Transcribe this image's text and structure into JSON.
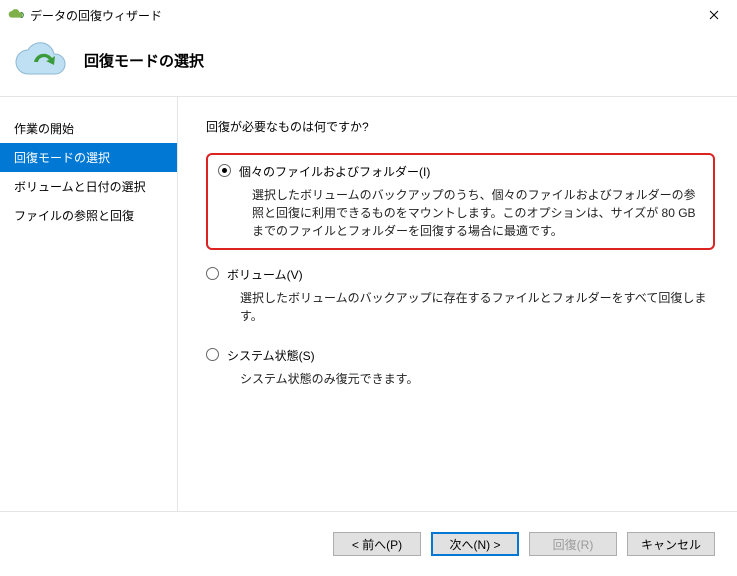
{
  "titlebar": {
    "title": "データの回復ウィザード"
  },
  "header": {
    "heading": "回復モードの選択"
  },
  "sidebar": {
    "items": [
      {
        "label": "作業の開始",
        "active": false
      },
      {
        "label": "回復モードの選択",
        "active": true
      },
      {
        "label": "ボリュームと日付の選択",
        "active": false
      },
      {
        "label": "ファイルの参照と回復",
        "active": false
      }
    ]
  },
  "main": {
    "question": "回復が必要なものは何ですか?",
    "options": [
      {
        "label": "個々のファイルおよびフォルダー(I)",
        "desc": "選択したボリュームのバックアップのうち、個々のファイルおよびフォルダーの参照と回復に利用できるものをマウントします。このオプションは、サイズが 80 GB までのファイルとフォルダーを回復する場合に最適です。",
        "checked": true,
        "highlighted": true
      },
      {
        "label": "ボリューム(V)",
        "desc": "選択したボリュームのバックアップに存在するファイルとフォルダーをすべて回復します。",
        "checked": false,
        "highlighted": false
      },
      {
        "label": "システム状態(S)",
        "desc": "システム状態のみ復元できます。",
        "checked": false,
        "highlighted": false
      }
    ]
  },
  "footer": {
    "prev": "< 前へ(P)",
    "next": "次へ(N) >",
    "recover": "回復(R)",
    "cancel": "キャンセル"
  }
}
